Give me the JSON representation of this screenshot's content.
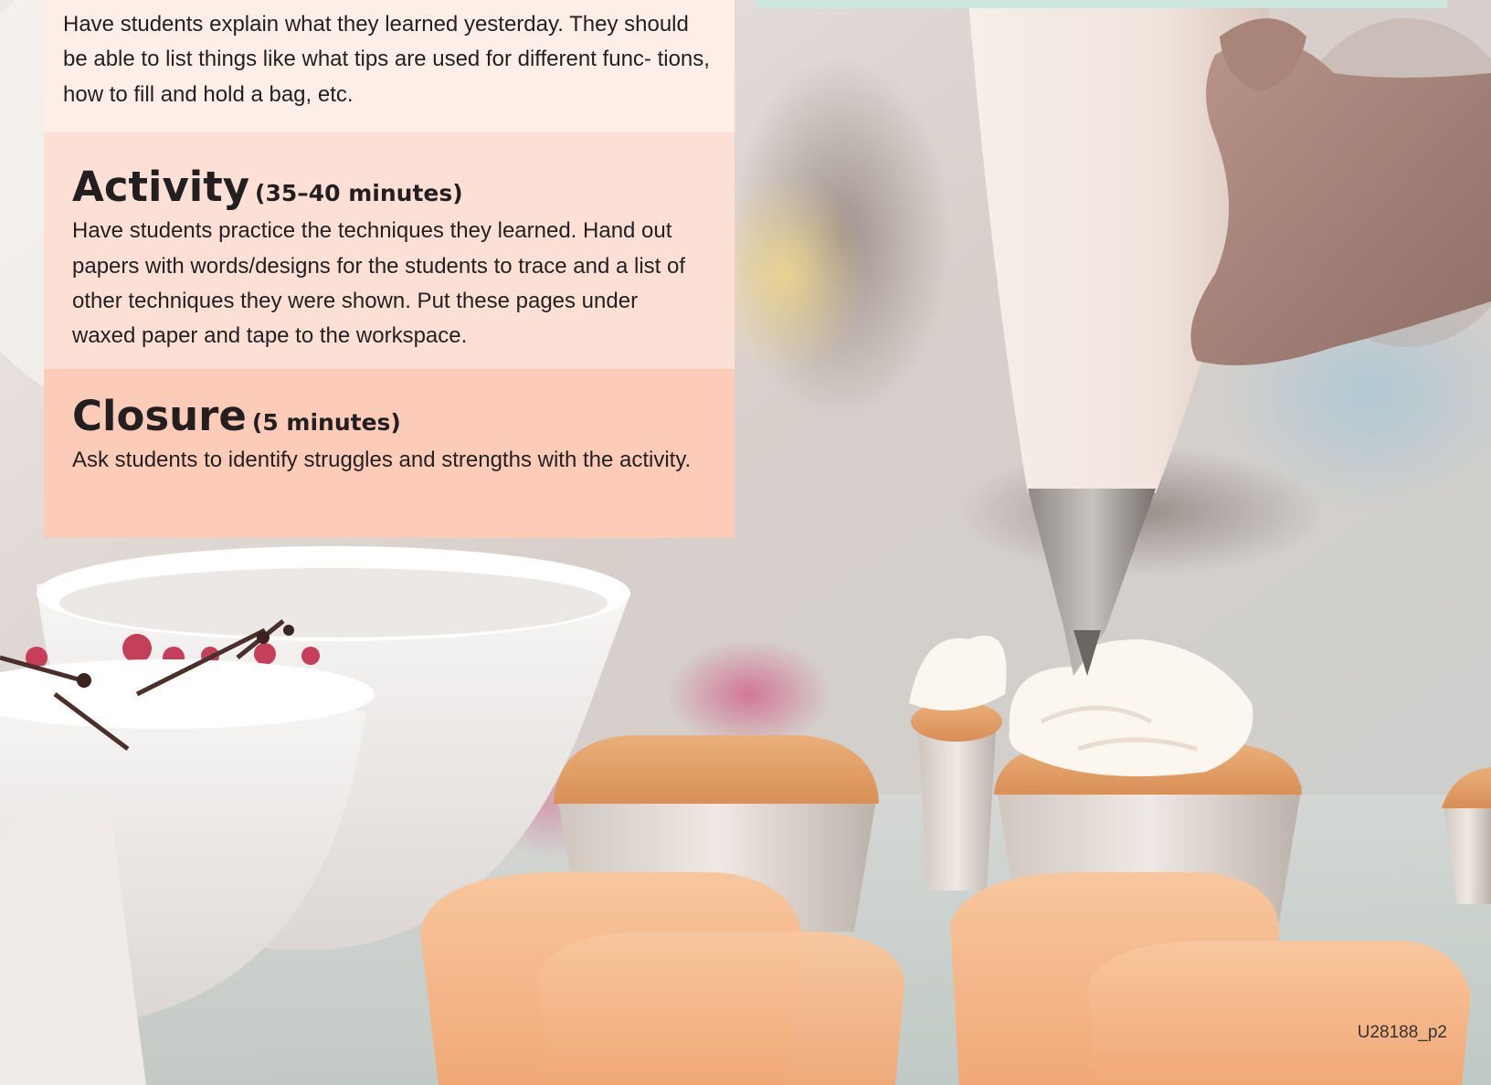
{
  "review": {
    "body": "Have students explain what they learned yesterday. They should be able to list things like what tips are used for different func- tions, how to fill and hold a bag, etc."
  },
  "activity": {
    "title": "Activity",
    "duration": "(35–40 minutes)",
    "body": "Have students practice the techniques they learned. Hand out papers with words/designs for the students to trace and a list of other techniques they were shown. Put these pages under waxed paper and tape to the workspace."
  },
  "closure": {
    "title": "Closure",
    "duration": "(5 minutes)",
    "body": "Ask students to identify struggles and strengths with the activity."
  },
  "footer": {
    "page_id": "U28188_p2"
  },
  "photo": {
    "subject": "piping-bag-frosting-cupcakes",
    "colors": {
      "cake": "#e8a66e",
      "liner": "#f3c7a3",
      "frosting": "#fbf6ee",
      "bowl": "#f4f2f0",
      "berries": "#c53f5b",
      "background_blur": "#d9d1cc"
    }
  }
}
